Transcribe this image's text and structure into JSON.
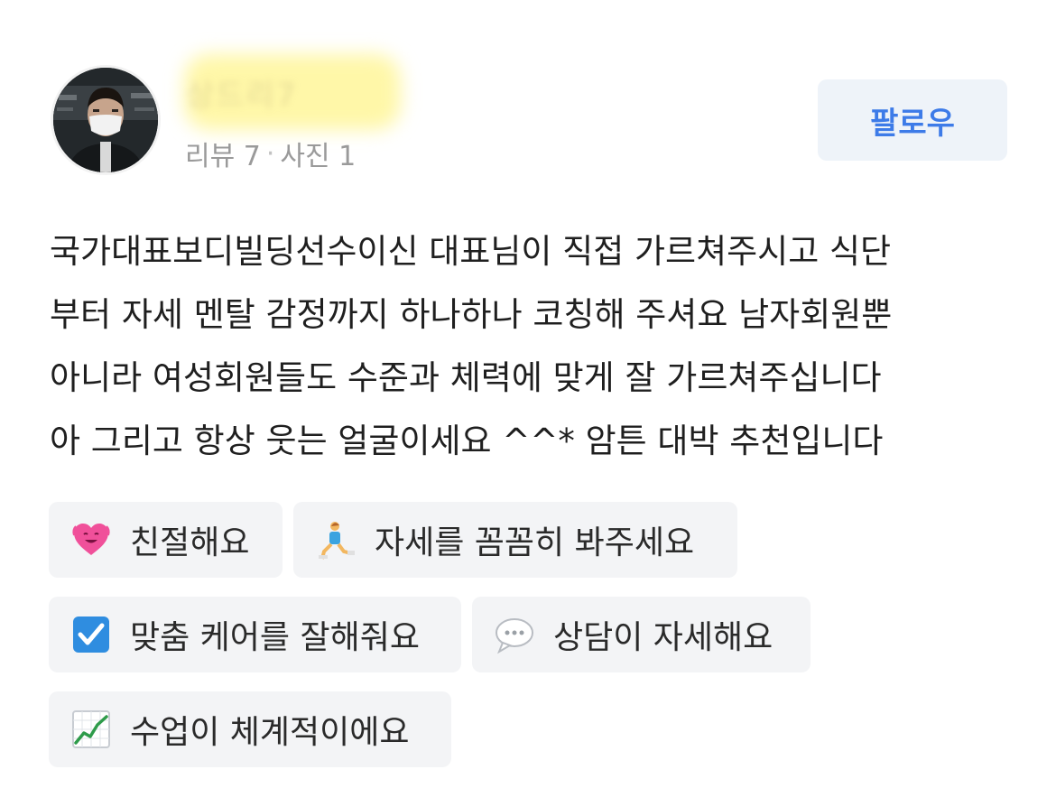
{
  "reviewer": {
    "name_blurred": "상드리7",
    "stats": {
      "reviews": "리뷰 7",
      "separator": "·",
      "photos": "사진 1"
    },
    "follow_label": "팔로우"
  },
  "review": {
    "lines": [
      "국가대표보디빌딩선수이신 대표님이 직접 가르쳐주시고 식단",
      "부터 자세 멘탈 감정까지 하나하나 코칭해 주셔요 남자회원뿐",
      "아니라 여성회원들도 수준과 체력에 맞게 잘 가르쳐주십니다",
      "아 그리고 항상 웃는 얼굴이세요 ^^* 암튼 대박 추천입니다"
    ]
  },
  "tags": [
    {
      "icon": "heart-icon",
      "label": "친절해요"
    },
    {
      "icon": "lunge-person-icon",
      "label": "자세를 꼼꼼히 봐주세요"
    },
    {
      "icon": "checkbox-icon",
      "label": "맞춤 케어를 잘해줘요"
    },
    {
      "icon": "speech-bubble-icon",
      "label": "상담이 자세해요"
    },
    {
      "icon": "chart-up-icon",
      "label": "수업이 체계적이에요"
    }
  ],
  "colors": {
    "accent": "#3d7be8",
    "tag_background": "#f3f4f6",
    "follow_background": "#eef3f9",
    "stats_text": "#9a9a9a",
    "name_highlight": "#fff7a8"
  }
}
